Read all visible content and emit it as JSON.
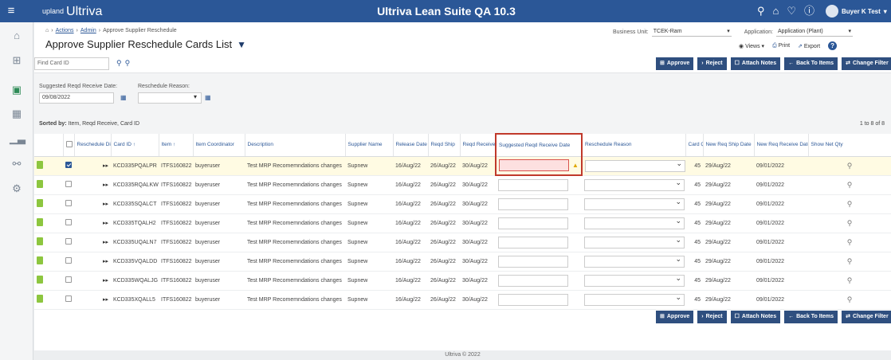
{
  "topbar": {
    "menu_icon": "hamburger-icon",
    "logo_small": "upland",
    "logo": "Ultriva",
    "title": "Ultriva Lean Suite QA 10.3",
    "user": "Buyer K Test",
    "icons": [
      "search-icon",
      "home-icon",
      "heart-icon",
      "help-icon"
    ]
  },
  "sidebar": {
    "icons": [
      "home-icon",
      "module-icon",
      "card-list-icon",
      "grid-icon",
      "chart-icon",
      "link-icon",
      "settings-icon"
    ],
    "active": 2
  },
  "breadcrumb": {
    "home": "⌂",
    "items": [
      "Actions",
      "Admin",
      "Approve Supplier Reschedule"
    ]
  },
  "page": {
    "title": "Approve Supplier Reschedule Cards List"
  },
  "header": {
    "bu_label": "Business Unit:",
    "bu_value": "TCEK-Ram",
    "app_label": "Application:",
    "app_value": "Application (Plant)",
    "views": "Views",
    "print": "Print",
    "export": "Export",
    "help": "?"
  },
  "find": {
    "placeholder": "Find Card ID"
  },
  "buttons": {
    "approve": "Approve",
    "reject": "Reject",
    "attach": "Attach Notes",
    "back": "Back To Items",
    "change": "Change Filter"
  },
  "filters": {
    "suggested_label": "Suggested Reqd Receive Date:",
    "suggested_value": "09/08/2022",
    "reason_label": "Reschedule Reason:",
    "reason_value": ""
  },
  "sort": {
    "label": "Sorted by:",
    "value": "Item, Reqd Receive, Card ID",
    "count": "1 to 8 of 8"
  },
  "columns": [
    "",
    "",
    "Reschedule Direction",
    "Card ID ↑",
    "Item ↑",
    "Item Coordinator",
    "Description",
    "Supplier Name",
    "Release Date",
    "Reqd Ship",
    "Reqd Receive",
    "Suggested Reqd Receive Date",
    "Reschedule Reason",
    "Card Qty",
    "New Req Ship Date",
    "New Req Receive Date",
    "Show Net Qty"
  ],
  "rows": [
    {
      "card": "KCD335PQALPR",
      "item": "ITFS160822",
      "coord": "buyeruser",
      "desc": "Test MRP Recomemndations changes",
      "supplier": "Supnew",
      "release": "16/Aug/22",
      "ship": "26/Aug/22",
      "receive": "30/Aug/22",
      "qty": "45",
      "new_ship": "29/Aug/22",
      "new_receive": "09/01/2022",
      "checked": true
    },
    {
      "card": "KCD335RQALKW",
      "item": "ITFS160822",
      "coord": "buyeruser",
      "desc": "Test MRP Recomemndations changes",
      "supplier": "Supnew",
      "release": "16/Aug/22",
      "ship": "26/Aug/22",
      "receive": "30/Aug/22",
      "qty": "45",
      "new_ship": "29/Aug/22",
      "new_receive": "09/01/2022",
      "checked": false
    },
    {
      "card": "KCD335SQALCT",
      "item": "ITFS160822",
      "coord": "buyeruser",
      "desc": "Test MRP Recomemndations changes",
      "supplier": "Supnew",
      "release": "16/Aug/22",
      "ship": "26/Aug/22",
      "receive": "30/Aug/22",
      "qty": "45",
      "new_ship": "29/Aug/22",
      "new_receive": "09/01/2022",
      "checked": false
    },
    {
      "card": "KCD335TQALH2",
      "item": "ITFS160822",
      "coord": "buyeruser",
      "desc": "Test MRP Recomemndations changes",
      "supplier": "Supnew",
      "release": "16/Aug/22",
      "ship": "26/Aug/22",
      "receive": "30/Aug/22",
      "qty": "45",
      "new_ship": "29/Aug/22",
      "new_receive": "09/01/2022",
      "checked": false
    },
    {
      "card": "KCD335UQALN7",
      "item": "ITFS160822",
      "coord": "buyeruser",
      "desc": "Test MRP Recomemndations changes",
      "supplier": "Supnew",
      "release": "16/Aug/22",
      "ship": "26/Aug/22",
      "receive": "30/Aug/22",
      "qty": "45",
      "new_ship": "29/Aug/22",
      "new_receive": "09/01/2022",
      "checked": false
    },
    {
      "card": "KCD335VQALDD",
      "item": "ITFS160822",
      "coord": "buyeruser",
      "desc": "Test MRP Recomemndations changes",
      "supplier": "Supnew",
      "release": "16/Aug/22",
      "ship": "26/Aug/22",
      "receive": "30/Aug/22",
      "qty": "45",
      "new_ship": "29/Aug/22",
      "new_receive": "09/01/2022",
      "checked": false
    },
    {
      "card": "KCD335WQALJG",
      "item": "ITFS160822",
      "coord": "buyeruser",
      "desc": "Test MRP Recomemndations changes",
      "supplier": "Supnew",
      "release": "16/Aug/22",
      "ship": "26/Aug/22",
      "receive": "30/Aug/22",
      "qty": "45",
      "new_ship": "29/Aug/22",
      "new_receive": "09/01/2022",
      "checked": false
    },
    {
      "card": "KCD335XQALL5",
      "item": "ITFS160822",
      "coord": "buyeruser",
      "desc": "Test MRP Recomemndations changes",
      "supplier": "Supnew",
      "release": "16/Aug/22",
      "ship": "26/Aug/22",
      "receive": "30/Aug/22",
      "qty": "45",
      "new_ship": "29/Aug/22",
      "new_receive": "09/01/2022",
      "checked": false
    }
  ],
  "footer": {
    "text": "Ultriva © 2022"
  },
  "colors": {
    "topbar": "#2b5797",
    "button": "#2f4f7f",
    "highlight": "#c0392b",
    "selected_row": "#fffbe3"
  }
}
